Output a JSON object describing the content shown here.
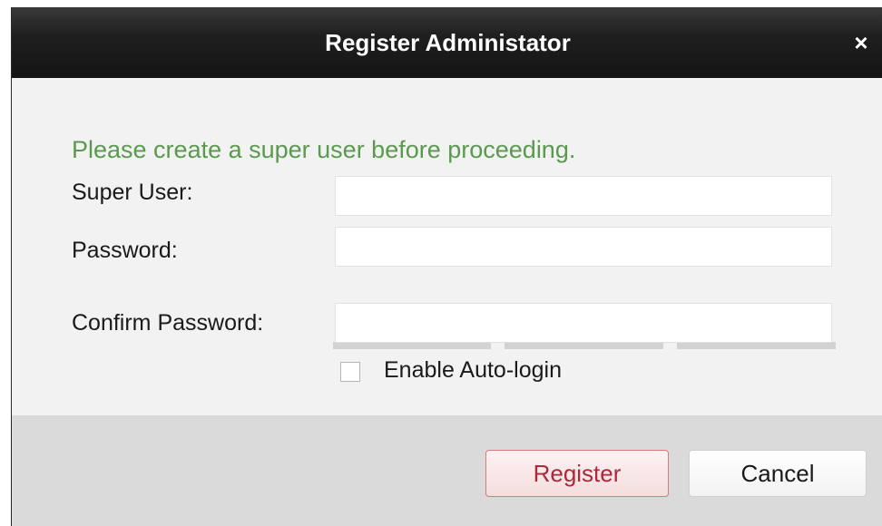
{
  "dialog": {
    "title": "Register Administator",
    "close_symbol": "×",
    "close_icon": "close-icon"
  },
  "form": {
    "message": "Please create a super user before proceeding.",
    "super_user_label": "Super User:",
    "super_user_value": "",
    "password_label": "Password:",
    "password_value": "",
    "password_strength_segments": 3,
    "confirm_password_label": "Confirm Password:",
    "confirm_password_value": "",
    "auto_login_label": "Enable Auto-login",
    "auto_login_checked": false
  },
  "buttons": {
    "register": "Register",
    "cancel": "Cancel"
  },
  "colors": {
    "titlebar": "#1f1f1f",
    "message": "#5a9a4e",
    "register_border": "#d97b7b",
    "register_text": "#b0263a"
  }
}
